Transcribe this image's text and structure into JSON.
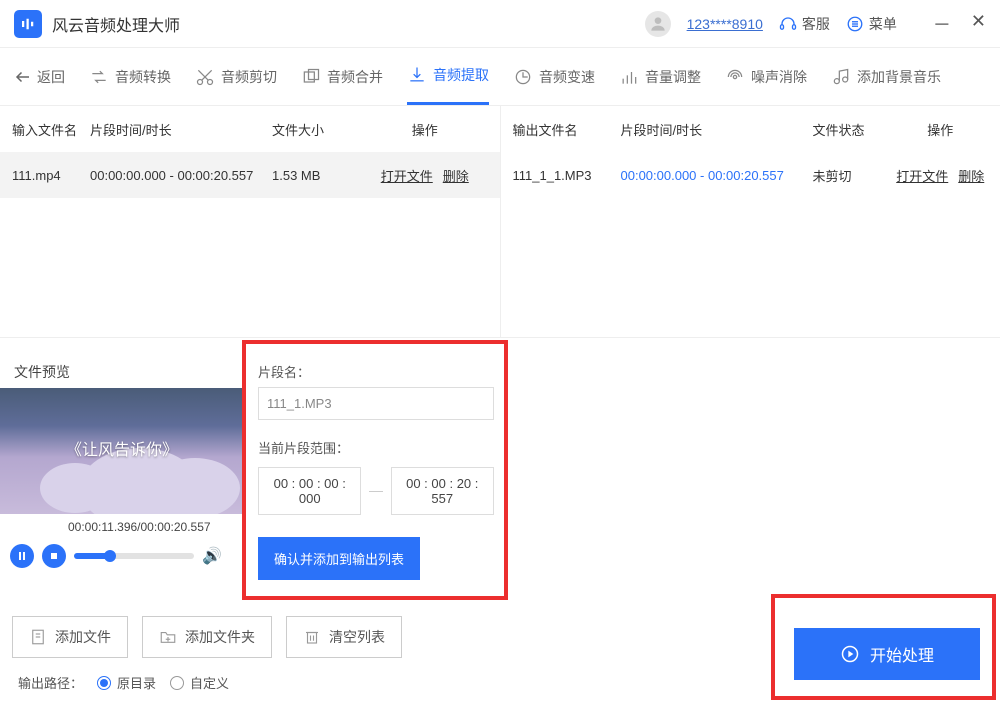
{
  "app": {
    "title": "风云音频处理大师"
  },
  "header": {
    "user_id": "123****8910",
    "customer_service": "客服",
    "menu": "菜单"
  },
  "tabs": {
    "back": "返回",
    "convert": "音频转换",
    "cut": "音频剪切",
    "merge": "音频合并",
    "extract": "音频提取",
    "speed": "音频变速",
    "volume": "音量调整",
    "denoise": "噪声消除",
    "bgm": "添加背景音乐"
  },
  "table": {
    "input": {
      "col_name": "输入文件名",
      "col_time": "片段时间/时长",
      "col_size": "文件大小",
      "col_op": "操作",
      "rows": [
        {
          "name": "111.mp4",
          "time": "00:00:00.000 - 00:00:20.557",
          "size": "1.53 MB",
          "open": "打开文件",
          "del": "删除"
        }
      ]
    },
    "output": {
      "col_name": "输出文件名",
      "col_time": "片段时间/时长",
      "col_status": "文件状态",
      "col_op": "操作",
      "rows": [
        {
          "name": "111_1_1.MP3",
          "time": "00:00:00.000 - 00:00:20.557",
          "status": "未剪切",
          "open": "打开文件",
          "del": "删除"
        }
      ]
    }
  },
  "preview": {
    "label": "文件预览",
    "video_title": "《让风告诉你》",
    "time": "00:00:11.396/00:00:20.557"
  },
  "clip": {
    "name_label": "片段名：",
    "name_value": "111_1.MP3",
    "range_label": "当前片段范围：",
    "range_start": "00 : 00 : 00 : 000",
    "range_end": "00 : 00 : 20 : 557",
    "confirm": "确认并添加到输出列表"
  },
  "bottom": {
    "add_file": "添加文件",
    "add_folder": "添加文件夹",
    "clear": "清空列表",
    "path_label": "输出路径：",
    "radio_original": "原目录",
    "radio_custom": "自定义",
    "start": "开始处理"
  }
}
